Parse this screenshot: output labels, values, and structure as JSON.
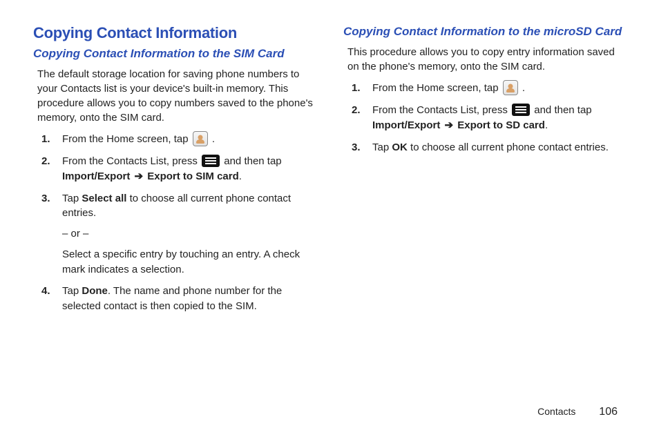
{
  "left": {
    "h1": "Copying Contact Information",
    "h2": "Copying Contact Information to the SIM Card",
    "intro": "The default storage location for saving phone numbers to your Contacts list is your device's built-in memory. This procedure allows you to copy numbers saved to the phone's memory, onto the SIM card.",
    "s1_a": "From the Home screen, tap ",
    "s1_b": " .",
    "s2_a": "From the Contacts List, press ",
    "s2_b": " and then tap ",
    "s2_c": "Import/Export",
    "s2_arrow": " ➔ ",
    "s2_d": "Export to SIM card",
    "s2_e": ".",
    "s3_a": "Tap ",
    "s3_b": "Select all",
    "s3_c": " to choose all current phone contact entries.",
    "s3_or": "– or –",
    "s3_d": "Select a specific entry by touching an entry. A check mark indicates a selection.",
    "s4_a": "Tap ",
    "s4_b": "Done",
    "s4_c": ". The name and phone number for the selected contact is then copied to the SIM."
  },
  "right": {
    "h2": "Copying Contact Information to the microSD Card",
    "intro": "This procedure allows you to copy entry information saved on the phone's memory, onto the SIM card.",
    "s1_a": "From the Home screen, tap ",
    "s1_b": " .",
    "s2_a": "From the Contacts List, press ",
    "s2_b": " and then tap ",
    "s2_c": "Import/Export",
    "s2_arrow": " ➔ ",
    "s2_d": "Export to SD card",
    "s2_e": ".",
    "s3_a": "Tap ",
    "s3_b": "OK",
    "s3_c": " to choose all current phone contact entries."
  },
  "footer": {
    "section": "Contacts",
    "page": "106"
  }
}
